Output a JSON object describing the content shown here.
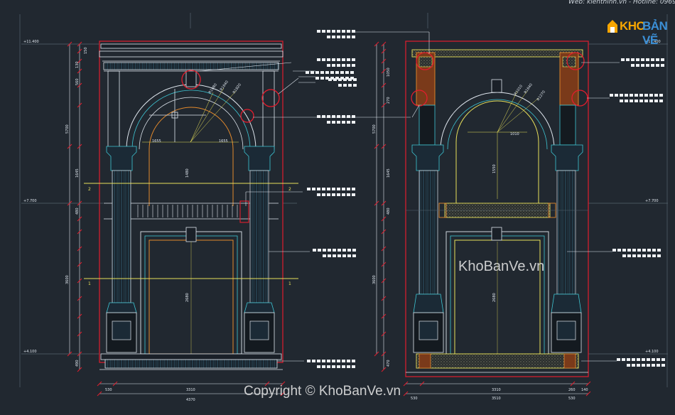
{
  "header": {
    "web_text": "Web: kienthinh.vn - Hotline: 0969.4"
  },
  "logo": {
    "part1": "KHO",
    "part2": "BẢN VẼ"
  },
  "watermark": {
    "text": "KhoBanVe.vn"
  },
  "copyright": {
    "text": "Copyright © KhoBanVe.vn"
  },
  "levels": [
    "+11.400",
    "+7.700",
    "+4.100",
    "+11.400",
    "+7.700",
    "+4.100"
  ],
  "left_elevation": {
    "arc_dims": [
      "R1080",
      "R1640",
      "R1820"
    ],
    "arc_chords": [
      "1655",
      "1655"
    ],
    "inner_dims": [
      "1480",
      "2680"
    ],
    "section_marks": [
      "2",
      "2",
      "1",
      "1"
    ],
    "vertical_dims": [
      "5700",
      "1645",
      "3600",
      "480",
      "560",
      "490",
      "150",
      "130"
    ],
    "bottom_dims": [
      "530",
      "3310",
      "4370"
    ]
  },
  "right_elevation": {
    "arc_dims": [
      "R1010",
      "R1640",
      "R1270"
    ],
    "chord": "1010",
    "inner_dims": [
      "1550",
      "2680"
    ],
    "vertical_dims": [
      "1050",
      "5700",
      "1645",
      "3600",
      "480",
      "470",
      "270"
    ],
    "bottom_dims": [
      "3310",
      "260",
      "140",
      "530",
      "3510",
      "530"
    ]
  },
  "colors": {
    "background": "#212830",
    "outline": "#dfe6ee",
    "cyan": "#3ec6d4",
    "red": "#e21d2d",
    "orange": "#e48a2c",
    "yellow": "#e8e05a",
    "grid": "#5d6b78"
  }
}
